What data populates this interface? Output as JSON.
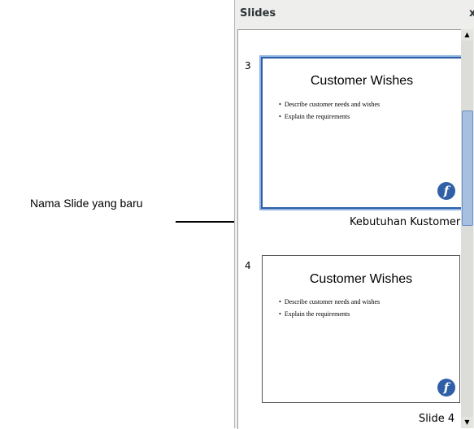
{
  "annotation": {
    "label": "Nama Slide yang baru"
  },
  "panel": {
    "title": "Slides",
    "close_symbol": "x"
  },
  "slides": [
    {
      "number": "3",
      "title": "Customer Wishes",
      "bullets": [
        "Describe customer needs and wishes",
        "Explain the requirements"
      ],
      "logo_glyph": "f",
      "name": "Kebutuhan Kustomer",
      "selected": true
    },
    {
      "number": "4",
      "title": "Customer Wishes",
      "bullets": [
        "Describe customer needs and wishes",
        "Explain the requirements"
      ],
      "logo_glyph": "f",
      "name": "Slide 4",
      "selected": false
    }
  ],
  "scrollbar": {
    "up_arrow": "▲",
    "down_arrow": "▼"
  },
  "colors": {
    "selection": "#2b5fa5",
    "logo": "#2f5fa7",
    "panel_bg": "#eeeeec"
  }
}
